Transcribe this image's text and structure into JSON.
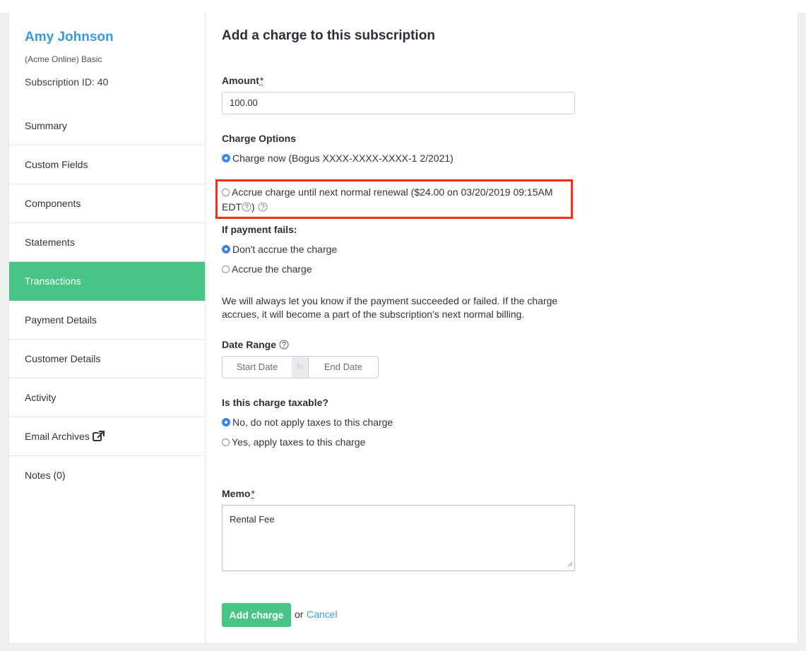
{
  "customer": {
    "name": "Amy Johnson",
    "plan": "(Acme Online) Basic",
    "subscription_id": "Subscription ID: 40"
  },
  "nav": {
    "items": [
      {
        "label": "Summary"
      },
      {
        "label": "Custom Fields"
      },
      {
        "label": "Components"
      },
      {
        "label": "Statements"
      },
      {
        "label": "Transactions",
        "active": true
      },
      {
        "label": "Payment Details"
      },
      {
        "label": "Customer Details"
      },
      {
        "label": "Activity"
      },
      {
        "label": "Email Archives",
        "icon": "external-link-icon"
      },
      {
        "label": "Notes (0)"
      }
    ]
  },
  "form": {
    "title": "Add a charge to this subscription",
    "amount_label": "Amount",
    "required_mark": "*",
    "amount_value": "100.00",
    "charge_options_label": "Charge Options",
    "charge_now_label": "Charge now (Bogus XXXX-XXXX-XXXX-1 2/2021)",
    "accrue_label": "Accrue charge until next normal renewal ($24.00 on 03/20/2019 09:15AM EDT",
    "accrue_close": ")",
    "payment_fails_label": "If payment fails:",
    "dont_accrue_label": "Don't accrue the charge",
    "accrue_charge_label": "Accrue the charge",
    "payment_note": "We will always let you know if the payment succeeded or failed. If the charge accrues, it will become a part of the subscription's next normal billing.",
    "date_range_label": "Date Range",
    "start_date_placeholder": "Start Date",
    "date_to": "to",
    "end_date_placeholder": "End Date",
    "taxable_label": "Is this charge taxable?",
    "no_tax_label": "No, do not apply taxes to this charge",
    "yes_tax_label": "Yes, apply taxes to this charge",
    "memo_label": "Memo",
    "memo_value": "Rental Fee",
    "submit_label": "Add charge",
    "or_text": "or",
    "cancel_label": "Cancel"
  },
  "colors": {
    "accent_green": "#48c585",
    "link_blue": "#3a9ad9",
    "radio_blue": "#3a85e8",
    "highlight_red": "#ff2a14"
  }
}
